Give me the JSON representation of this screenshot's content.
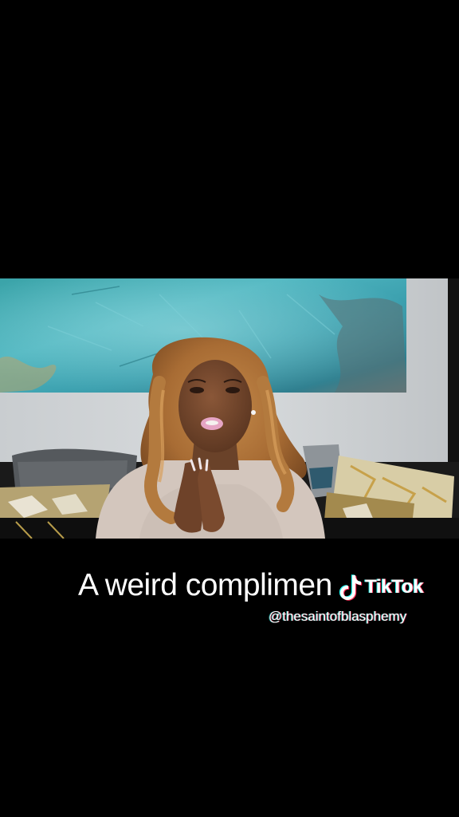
{
  "caption": {
    "text": "A weird complimen"
  },
  "watermark": {
    "logo_icon": "tiktok-logo-icon",
    "brand": "TikTok",
    "handle": "@thesaintofblasphemy"
  },
  "colors": {
    "background": "#000000",
    "text": "#ffffff",
    "tiktok_cyan": "#25f4ee",
    "tiktok_red": "#fe2c55"
  }
}
